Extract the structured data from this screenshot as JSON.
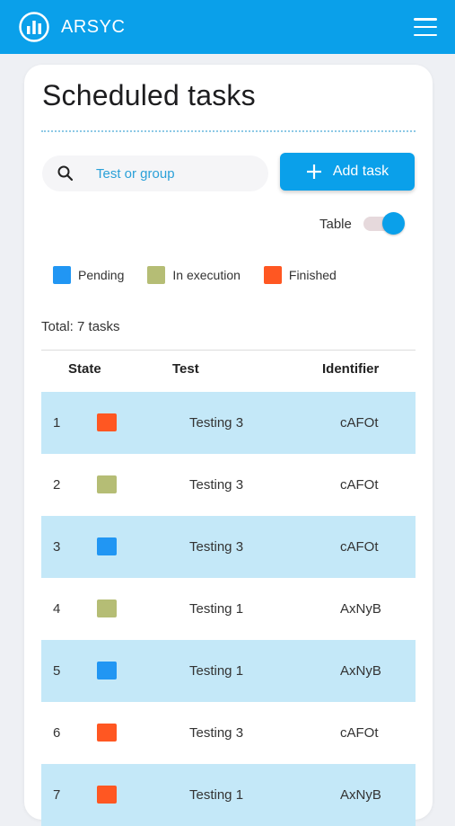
{
  "app": {
    "brand": "ARSYC",
    "logo_icon": "chart-circle-logo-icon",
    "menu_icon": "hamburger-menu-icon",
    "accent": "#0aa0ea"
  },
  "page": {
    "title": "Scheduled tasks"
  },
  "search": {
    "placeholder": "Test or group",
    "value": "",
    "icon": "search-icon"
  },
  "add_task": {
    "label": "Add task",
    "icon": "plus-icon"
  },
  "view_toggle": {
    "label": "Table",
    "on": true
  },
  "legend": [
    {
      "label": "Pending",
      "color": "#2196f3"
    },
    {
      "label": "In execution",
      "color": "#b5bd75"
    },
    {
      "label": "Finished",
      "color": "#ff5722"
    }
  ],
  "total": "Total: 7 tasks",
  "table": {
    "headers": {
      "state": "State",
      "test": "Test",
      "identifier": "Identifier"
    },
    "stripe_color": "#c4e8f8",
    "rows": [
      {
        "num": "1",
        "state": "Finished",
        "test": "Testing 3",
        "identifier": "cAFOt"
      },
      {
        "num": "2",
        "state": "In execution",
        "test": "Testing 3",
        "identifier": "cAFOt"
      },
      {
        "num": "3",
        "state": "Pending",
        "test": "Testing 3",
        "identifier": "cAFOt"
      },
      {
        "num": "4",
        "state": "In execution",
        "test": "Testing 1",
        "identifier": "AxNyB"
      },
      {
        "num": "5",
        "state": "Pending",
        "test": "Testing 1",
        "identifier": "AxNyB"
      },
      {
        "num": "6",
        "state": "Finished",
        "test": "Testing 3",
        "identifier": "cAFOt"
      },
      {
        "num": "7",
        "state": "Finished",
        "test": "Testing 1",
        "identifier": "AxNyB"
      }
    ]
  }
}
